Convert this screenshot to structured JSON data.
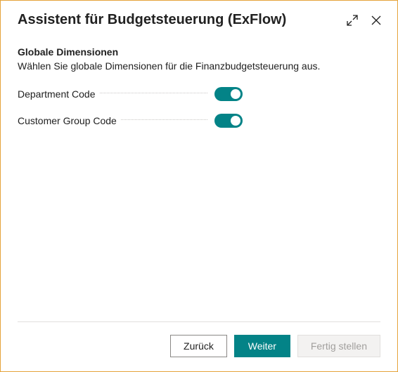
{
  "header": {
    "title": "Assistent für Budgetsteuerung (ExFlow)"
  },
  "section": {
    "title": "Globale Dimensionen",
    "description": "Wählen Sie globale Dimensionen für die Finanzbudgetsteuerung aus."
  },
  "fields": [
    {
      "label": "Department Code",
      "on": true
    },
    {
      "label": "Customer Group Code",
      "on": true
    }
  ],
  "footer": {
    "back": "Zurück",
    "next": "Weiter",
    "finish": "Fertig stellen"
  }
}
